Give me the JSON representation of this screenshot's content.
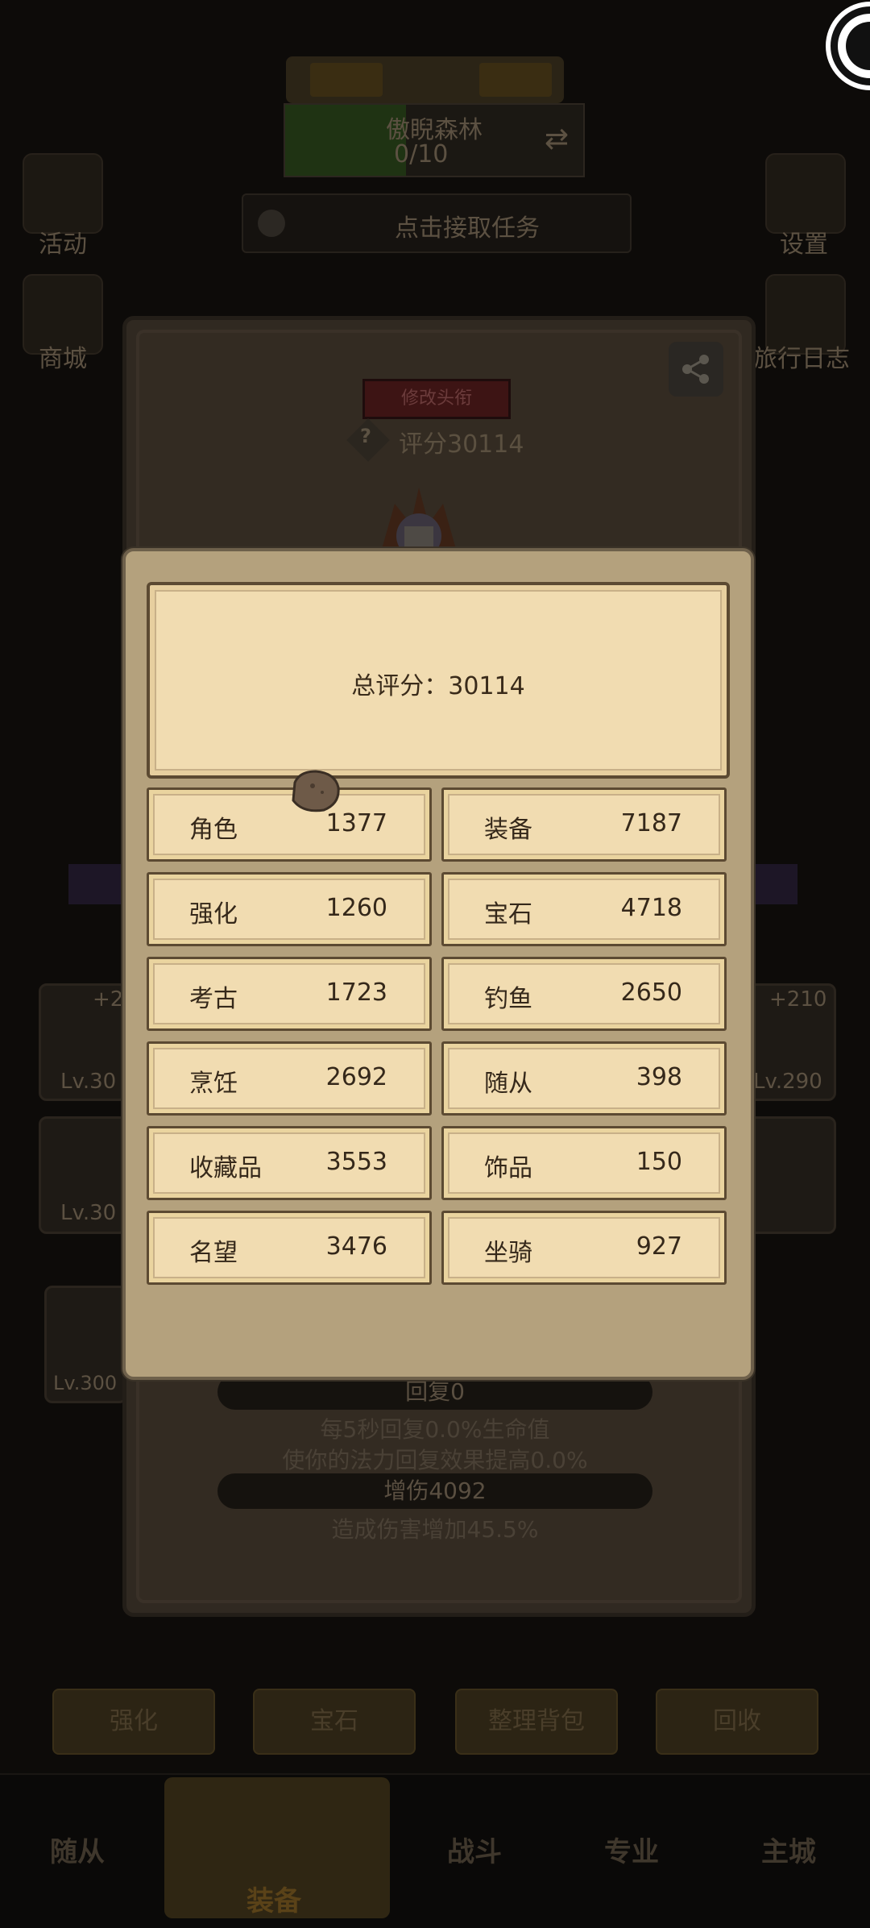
{
  "background": {
    "area_name": "傲睨森林",
    "area_progress": "0/10",
    "quest_prompt": "点击接取任务",
    "left_icons": [
      {
        "label": "活动",
        "icon": "activity-icon"
      },
      {
        "label": "商城",
        "icon": "store-icon"
      }
    ],
    "right_icons": [
      {
        "label": "设置",
        "icon": "gear-icon"
      },
      {
        "label": "旅行日志",
        "icon": "book-icon"
      }
    ],
    "left_badges": [
      "+2",
      "Lv.30",
      "Lv.30",
      "Lv.300"
    ],
    "right_badges": [
      "+210",
      "Lv.290"
    ],
    "action_buttons": [
      "强化",
      "宝石",
      "整理背包",
      "回收"
    ],
    "nav": [
      "随从",
      "装备",
      "战斗",
      "专业",
      "主城"
    ],
    "nav_selected": "装备"
  },
  "character_panel": {
    "title_button": "修改头衔",
    "score_text": "评分30114",
    "stats": [
      {
        "pill": "回复0",
        "desc": [
          "每5秒回复0.0%生命值",
          "使你的法力回复效果提高0.0%"
        ]
      },
      {
        "pill": "增伤4092",
        "desc": [
          "造成伤害增加45.5%"
        ]
      }
    ]
  },
  "score_modal": {
    "total_text": "总评分：30114",
    "items": [
      {
        "label": "角色",
        "value": "1377"
      },
      {
        "label": "装备",
        "value": "7187"
      },
      {
        "label": "强化",
        "value": "1260"
      },
      {
        "label": "宝石",
        "value": "4718"
      },
      {
        "label": "考古",
        "value": "1723"
      },
      {
        "label": "钓鱼",
        "value": "2650"
      },
      {
        "label": "烹饪",
        "value": "2692"
      },
      {
        "label": "随从",
        "value": "398"
      },
      {
        "label": "收藏品",
        "value": "3553"
      },
      {
        "label": "饰品",
        "value": "150"
      },
      {
        "label": "名望",
        "value": "3476"
      },
      {
        "label": "坐骑",
        "value": "927"
      }
    ]
  },
  "colors": {
    "parchment": "#f1dcb1",
    "modal_frame": "#b4a17d",
    "text_dark": "#35281a"
  }
}
